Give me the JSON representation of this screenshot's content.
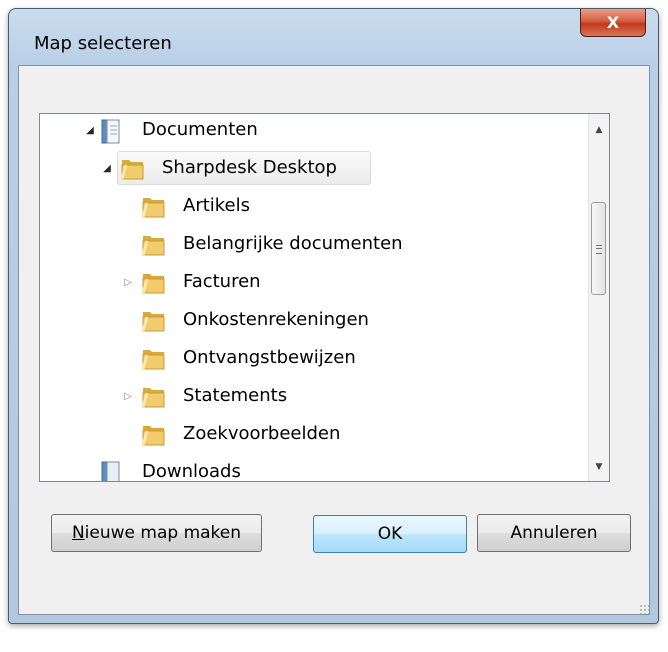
{
  "window": {
    "title": "Map selecteren",
    "close_label": "X"
  },
  "tree": {
    "items": [
      {
        "label": "Documenten",
        "expander": "open",
        "icon": "library-icon"
      },
      {
        "label": "Sharpdesk Desktop",
        "expander": "open",
        "icon": "folder-icon",
        "selected": true
      },
      {
        "label": "Artikels",
        "expander": "none",
        "icon": "folder-icon"
      },
      {
        "label": "Belangrijke documenten",
        "expander": "none",
        "icon": "folder-icon"
      },
      {
        "label": "Facturen",
        "expander": "closed",
        "icon": "folder-icon"
      },
      {
        "label": "Onkostenrekeningen",
        "expander": "none",
        "icon": "folder-icon"
      },
      {
        "label": "Ontvangstbewijzen",
        "expander": "none",
        "icon": "folder-icon"
      },
      {
        "label": "Statements",
        "expander": "closed",
        "icon": "folder-icon"
      },
      {
        "label": "Zoekvoorbeelden",
        "expander": "none",
        "icon": "folder-icon"
      },
      {
        "label": "Downloads",
        "expander": "none",
        "icon": "library-icon"
      }
    ]
  },
  "buttons": {
    "new_folder_first": "N",
    "new_folder_rest": "ieuwe map maken",
    "ok": "OK",
    "cancel": "Annuleren"
  },
  "colors": {
    "frame": "#b9cfe6",
    "close": "#c2381b",
    "folder": "#e8c158",
    "ok_border": "#3c7fb1"
  }
}
